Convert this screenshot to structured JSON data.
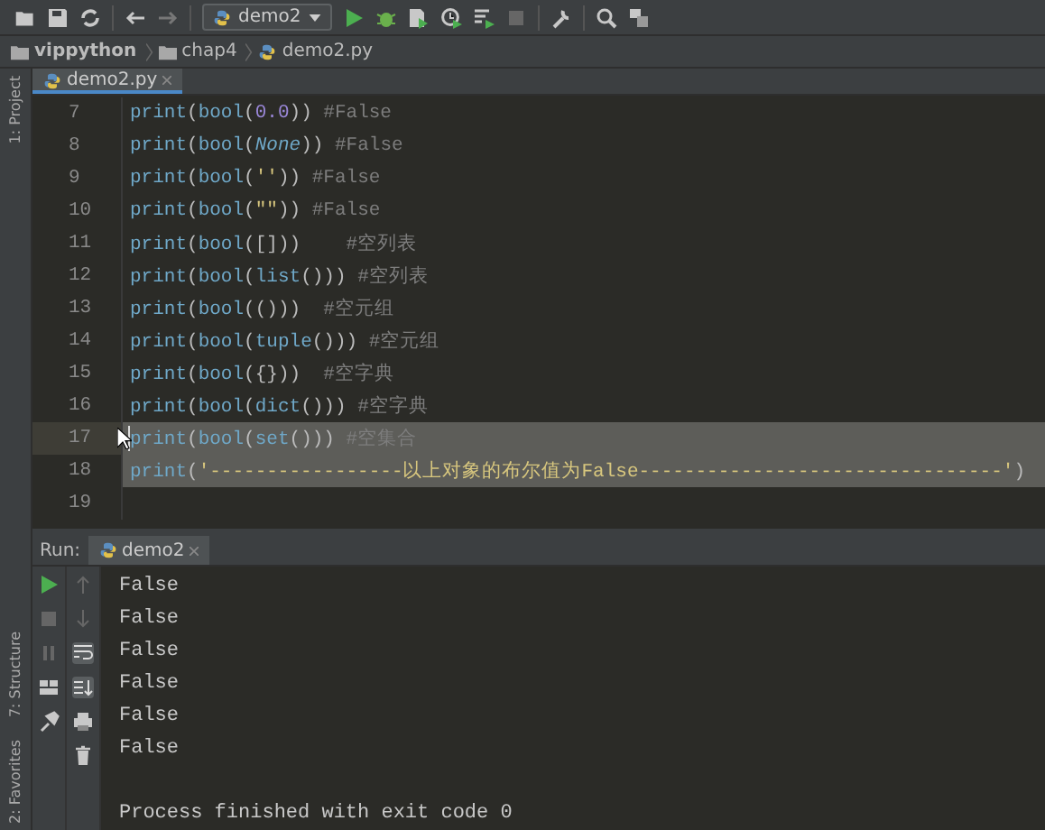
{
  "toolbar": {
    "run_config": "demo2"
  },
  "breadcrumb": [
    "vippython",
    "chap4",
    "demo2.py"
  ],
  "side_tools_top": [
    {
      "label": "1: Project"
    }
  ],
  "side_tools_bottom": [
    {
      "label": "7: Structure"
    },
    {
      "label": "2: Favorites"
    }
  ],
  "editor_tabs": [
    {
      "label": "demo2.py",
      "selected": true
    }
  ],
  "lines": [
    {
      "number": "7",
      "selected": false,
      "caret": false,
      "tokens": [
        {
          "kind": "fn",
          "text": "print"
        },
        {
          "kind": "p",
          "text": "("
        },
        {
          "kind": "fn",
          "text": "bool"
        },
        {
          "kind": "p",
          "text": "("
        },
        {
          "kind": "num",
          "text": "0.0"
        },
        {
          "kind": "p",
          "text": ")) "
        },
        {
          "kind": "comment",
          "text": "#False"
        }
      ]
    },
    {
      "number": "8",
      "selected": false,
      "caret": false,
      "tokens": [
        {
          "kind": "fn",
          "text": "print"
        },
        {
          "kind": "p",
          "text": "("
        },
        {
          "kind": "fn",
          "text": "bool"
        },
        {
          "kind": "p",
          "text": "("
        },
        {
          "kind": "kw",
          "text": "None"
        },
        {
          "kind": "p",
          "text": ")) "
        },
        {
          "kind": "comment",
          "text": "#False"
        }
      ]
    },
    {
      "number": "9",
      "selected": false,
      "caret": false,
      "tokens": [
        {
          "kind": "fn",
          "text": "print"
        },
        {
          "kind": "p",
          "text": "("
        },
        {
          "kind": "fn",
          "text": "bool"
        },
        {
          "kind": "p",
          "text": "("
        },
        {
          "kind": "str",
          "text": "''"
        },
        {
          "kind": "p",
          "text": ")) "
        },
        {
          "kind": "comment",
          "text": "#False"
        }
      ]
    },
    {
      "number": "10",
      "selected": false,
      "caret": false,
      "tokens": [
        {
          "kind": "fn",
          "text": "print"
        },
        {
          "kind": "p",
          "text": "("
        },
        {
          "kind": "fn",
          "text": "bool"
        },
        {
          "kind": "p",
          "text": "("
        },
        {
          "kind": "str",
          "text": "\"\""
        },
        {
          "kind": "p",
          "text": ")) "
        },
        {
          "kind": "comment",
          "text": "#False"
        }
      ]
    },
    {
      "number": "11",
      "selected": false,
      "caret": false,
      "tokens": [
        {
          "kind": "fn",
          "text": "print"
        },
        {
          "kind": "p",
          "text": "("
        },
        {
          "kind": "fn",
          "text": "bool"
        },
        {
          "kind": "p",
          "text": "([]))    "
        },
        {
          "kind": "comment",
          "text": "#空列表"
        }
      ]
    },
    {
      "number": "12",
      "selected": false,
      "caret": false,
      "tokens": [
        {
          "kind": "fn",
          "text": "print"
        },
        {
          "kind": "p",
          "text": "("
        },
        {
          "kind": "fn",
          "text": "bool"
        },
        {
          "kind": "p",
          "text": "("
        },
        {
          "kind": "fn",
          "text": "list"
        },
        {
          "kind": "p",
          "text": "())) "
        },
        {
          "kind": "comment",
          "text": "#空列表"
        }
      ]
    },
    {
      "number": "13",
      "selected": false,
      "caret": false,
      "tokens": [
        {
          "kind": "fn",
          "text": "print"
        },
        {
          "kind": "p",
          "text": "("
        },
        {
          "kind": "fn",
          "text": "bool"
        },
        {
          "kind": "p",
          "text": "(()))  "
        },
        {
          "kind": "comment",
          "text": "#空元组"
        }
      ]
    },
    {
      "number": "14",
      "selected": false,
      "caret": false,
      "tokens": [
        {
          "kind": "fn",
          "text": "print"
        },
        {
          "kind": "p",
          "text": "("
        },
        {
          "kind": "fn",
          "text": "bool"
        },
        {
          "kind": "p",
          "text": "("
        },
        {
          "kind": "fn",
          "text": "tuple"
        },
        {
          "kind": "p",
          "text": "())) "
        },
        {
          "kind": "comment",
          "text": "#空元组"
        }
      ]
    },
    {
      "number": "15",
      "selected": false,
      "caret": false,
      "tokens": [
        {
          "kind": "fn",
          "text": "print"
        },
        {
          "kind": "p",
          "text": "("
        },
        {
          "kind": "fn",
          "text": "bool"
        },
        {
          "kind": "p",
          "text": "({}))  "
        },
        {
          "kind": "comment",
          "text": "#空字典"
        }
      ]
    },
    {
      "number": "16",
      "selected": false,
      "caret": false,
      "tokens": [
        {
          "kind": "fn",
          "text": "print"
        },
        {
          "kind": "p",
          "text": "("
        },
        {
          "kind": "fn",
          "text": "bool"
        },
        {
          "kind": "p",
          "text": "("
        },
        {
          "kind": "fn",
          "text": "dict"
        },
        {
          "kind": "p",
          "text": "())) "
        },
        {
          "kind": "comment",
          "text": "#空字典"
        }
      ]
    },
    {
      "number": "17",
      "selected": true,
      "caret": true,
      "tokens": [
        {
          "kind": "fn",
          "text": "print"
        },
        {
          "kind": "p",
          "text": "("
        },
        {
          "kind": "fn",
          "text": "bool"
        },
        {
          "kind": "p",
          "text": "("
        },
        {
          "kind": "fn",
          "text": "set"
        },
        {
          "kind": "p",
          "text": "())) "
        },
        {
          "kind": "comment",
          "text": "#空集合"
        }
      ]
    },
    {
      "number": "18",
      "selected": true,
      "caret": false,
      "tokens": [
        {
          "kind": "fn",
          "text": "print"
        },
        {
          "kind": "p",
          "text": "("
        },
        {
          "kind": "str",
          "text": "'-----------------以上对象的布尔值为False--------------------------------'"
        },
        {
          "kind": "p",
          "text": ")"
        }
      ]
    },
    {
      "number": "19",
      "selected": false,
      "caret": false
    }
  ],
  "run": {
    "label": "Run:",
    "tabs": [
      {
        "label": "demo2",
        "selected": true
      }
    ],
    "output": [
      "False",
      "False",
      "False",
      "False",
      "False",
      "False"
    ],
    "exit_message": "Process finished with exit code 0"
  }
}
